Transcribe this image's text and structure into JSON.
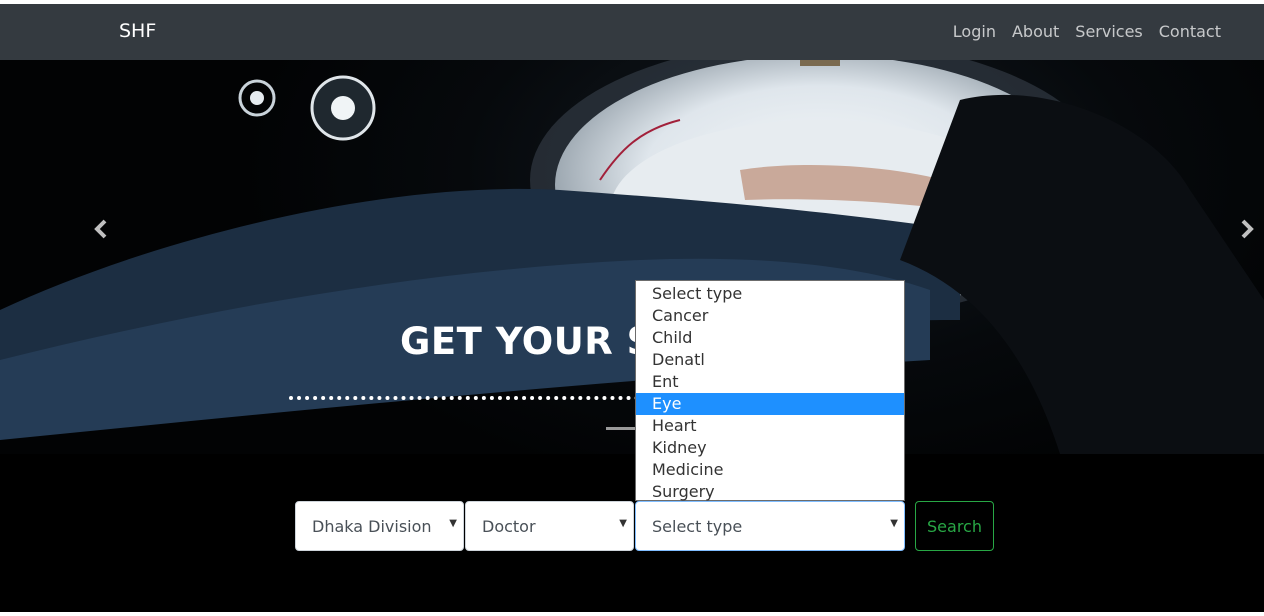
{
  "navbar": {
    "brand": "SHF",
    "links": [
      "Login",
      "About",
      "Services",
      "Contact"
    ]
  },
  "hero": {
    "headline": "GET YOUR SE"
  },
  "search": {
    "division": "Dhaka Division",
    "role": "Doctor",
    "type": "Select type",
    "button": "Search"
  },
  "dropdown": {
    "options": [
      "Select type",
      "Cancer",
      "Child",
      "Denatl",
      "Ent",
      "Eye",
      "Heart",
      "Kidney",
      "Medicine",
      "Surgery"
    ],
    "highlighted": "Eye"
  },
  "colors": {
    "navbar": "#343a40",
    "highlight": "#1e90ff",
    "search_button": "#28a745"
  }
}
